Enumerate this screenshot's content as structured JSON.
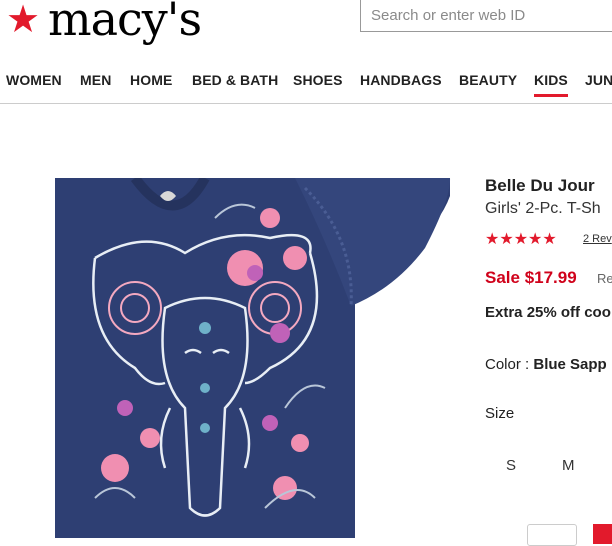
{
  "brand": {
    "logo_text": "macy's",
    "accent": "#e21a2c"
  },
  "search": {
    "placeholder": "Search or enter web ID"
  },
  "nav": {
    "items": [
      {
        "label": "WOMEN"
      },
      {
        "label": "MEN"
      },
      {
        "label": "HOME"
      },
      {
        "label": "BED & BATH"
      },
      {
        "label": "SHOES"
      },
      {
        "label": "HANDBAGS"
      },
      {
        "label": "BEAUTY"
      },
      {
        "label": "KIDS",
        "active": true
      },
      {
        "label": "JUN"
      }
    ]
  },
  "product": {
    "brand": "Belle Du Jour",
    "title": "Girls' 2-Pc. T-Sh",
    "rating_stars": "★★★★★",
    "rating_value": 5,
    "reviews_link": "2 Rev",
    "sale_price": "Sale $17.99",
    "reg_price": "Re",
    "promo": "Extra 25% off coo",
    "color_label": "Color : ",
    "color_value": "Blue Sapp",
    "size_label": "Size",
    "sizes": [
      "S",
      "M"
    ],
    "image_icon": "elephant-graphic-tshirt",
    "shirt_color": "#2e3f73",
    "price_color": "#d0021b"
  }
}
